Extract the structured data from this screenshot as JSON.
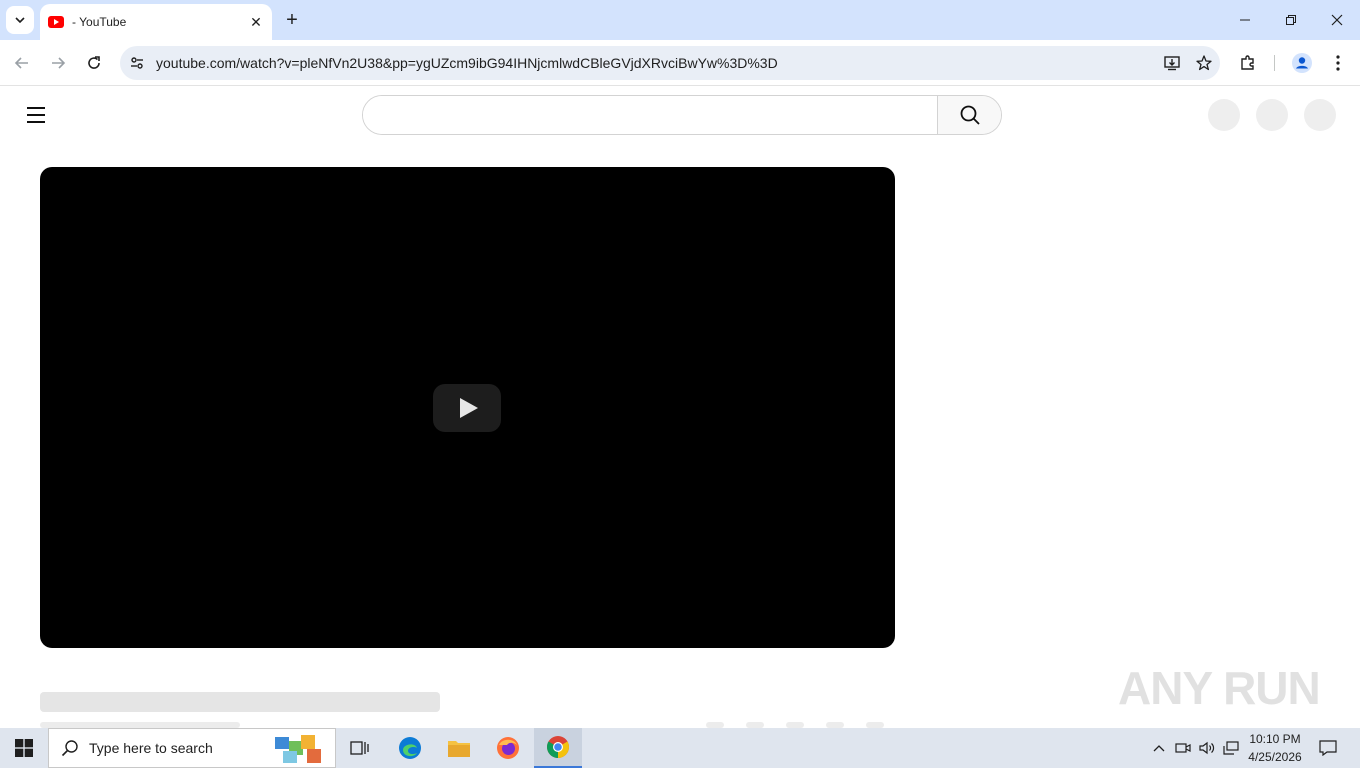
{
  "browser": {
    "tab_title": "- YouTube",
    "url": "youtube.com/watch?v=pleNfVn2U38&pp=ygUZcm9ibG94IHNjcmlwdCBleGVjdXRvciBwYw%3D%3D"
  },
  "youtube": {
    "search_value": "",
    "search_placeholder": ""
  },
  "watermark": {
    "text": "ANY RUN"
  },
  "taskbar": {
    "search_placeholder": "Type here to search",
    "time": "10:10 PM",
    "date": "4/25/2026"
  },
  "colors": {
    "tabstrip": "#d3e3fd",
    "youtube_red": "#ff0000",
    "player": "#000000"
  }
}
